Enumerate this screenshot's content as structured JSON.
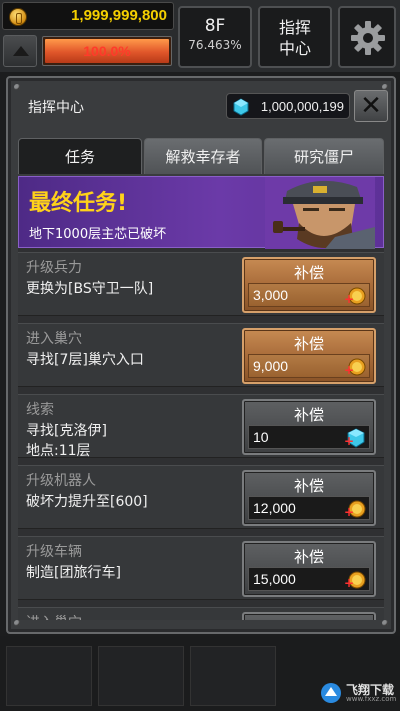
{
  "hud": {
    "coins": "1,999,999,800",
    "power": "100.0%",
    "power_level": 1.0,
    "floor": "8F",
    "floor_progress": "76.463%",
    "command_center_line1": "指挥",
    "command_center_line2": "中心"
  },
  "dialog": {
    "title": "指挥中心",
    "gems": "1,000,000,199",
    "tabs": [
      {
        "label": "任务",
        "active": true
      },
      {
        "label": "解救幸存者",
        "active": false
      },
      {
        "label": "研究僵尸",
        "active": false
      }
    ],
    "final_mission": {
      "title": "最终任务!",
      "subtitle": "地下1000层主芯已破坏"
    },
    "missions": [
      {
        "category": "升级兵力",
        "description": "更换为[BS守卫一队]",
        "reward_label": "补偿",
        "reward_value": "3,000",
        "reward_type": "coin",
        "style": "gold"
      },
      {
        "category": "进入巢穴",
        "description": "寻找[7层]巢穴入口",
        "reward_label": "补偿",
        "reward_value": "9,000",
        "reward_type": "coin",
        "style": "gold"
      },
      {
        "category": "线索",
        "description": "寻找[克洛伊]\n地点:11层",
        "reward_label": "补偿",
        "reward_value": "10",
        "reward_type": "gem",
        "style": "dark"
      },
      {
        "category": "升级机器人",
        "description": "破坏力提升至[600]",
        "reward_label": "补偿",
        "reward_value": "12,000",
        "reward_type": "coin",
        "style": "dark"
      },
      {
        "category": "升级车辆",
        "description": "制造[团旅行车]",
        "reward_label": "补偿",
        "reward_value": "15,000",
        "reward_type": "coin",
        "style": "dark"
      },
      {
        "category": "进入巢穴",
        "description": "",
        "reward_label": "",
        "reward_value": "",
        "reward_type": "coin",
        "style": "dark"
      }
    ]
  },
  "watermark": {
    "text": "飞翔下载",
    "url": "www.fxxz.com"
  }
}
